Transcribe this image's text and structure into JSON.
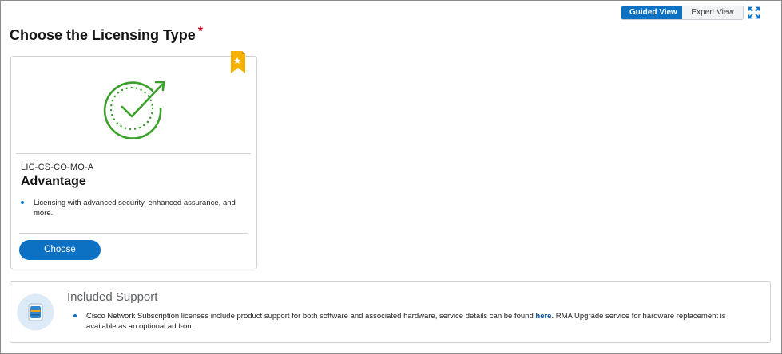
{
  "view_toggle": {
    "guided_label": "Guided View",
    "expert_label": "Expert View",
    "active": "guided"
  },
  "page": {
    "title": "Choose the Licensing Type",
    "required_marker": "*"
  },
  "license_card": {
    "sku": "LIC-CS-CO-MO-A",
    "name": "Advantage",
    "features": [
      "Licensing with advanced security, enhanced assurance, and more."
    ],
    "choose_label": "Choose",
    "badge_icon": "star-ribbon-icon"
  },
  "support": {
    "title": "Included Support",
    "text_before_link": "Cisco Network Subscription licenses include product support for both software and associated hardware, service details can be found ",
    "link_label": "here",
    "text_after_link": ". RMA Upgrade service for hardware replacement is available as an optional add-on.",
    "icon": "server-icon"
  },
  "colors": {
    "accent": "#0c71c3",
    "success_green": "#3aa02a",
    "badge_gold": "#f5b200",
    "required_red": "#d0021b"
  }
}
